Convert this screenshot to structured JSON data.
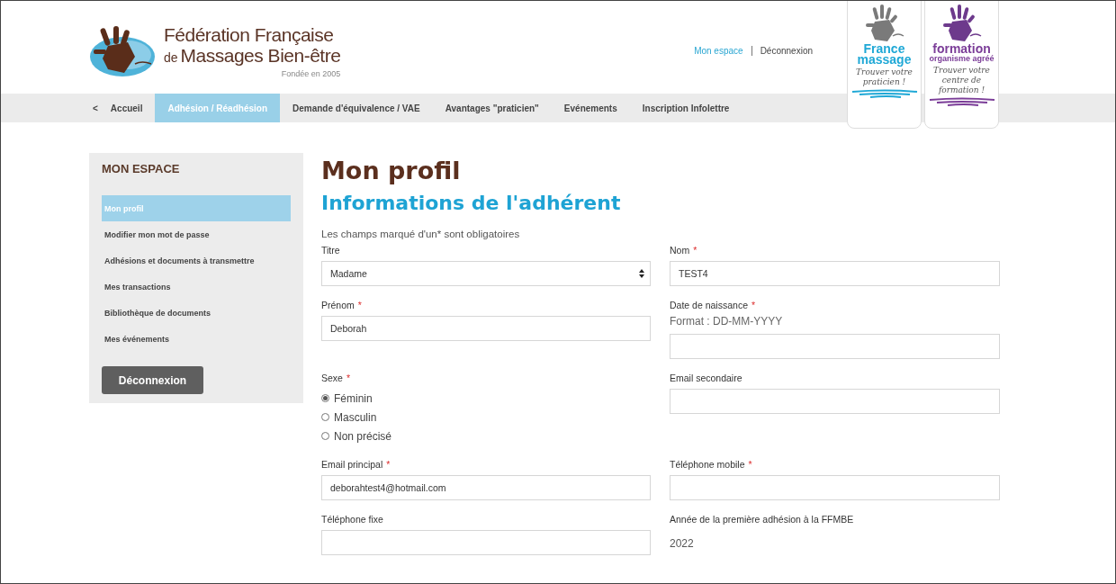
{
  "header": {
    "logo": {
      "title_line_1": "Fédération Française",
      "title_line_2_prefix": "de",
      "title_line_2": "Massages Bien-être",
      "tagline": "Fondée en 2005"
    },
    "top_links": [
      {
        "label": "Mon espace",
        "selected": true
      },
      {
        "label": "Déconnexion",
        "selected": false
      }
    ],
    "badges": [
      {
        "kind": "massage",
        "title": "France",
        "title_2": "massage",
        "caption": "Trouver votre praticien !",
        "color": "#1fa8d6"
      },
      {
        "kind": "formation",
        "title": "formation",
        "title_2": "organisme agréé",
        "caption": "Trouver votre centre de formation !",
        "color": "#7b3d98"
      }
    ]
  },
  "nav": [
    {
      "label": "<",
      "kind": "back"
    },
    {
      "label": "Accueil",
      "selected": false
    },
    {
      "label": "Adhésion / Réadhésion",
      "selected": true
    },
    {
      "label": "Demande d'équivalence / VAE",
      "selected": false
    },
    {
      "label": "Avantages \"praticien\"",
      "selected": false
    },
    {
      "label": "Evénements",
      "selected": false
    },
    {
      "label": "Inscription Infolettre",
      "selected": false
    }
  ],
  "sidebar": {
    "title": "MON ESPACE",
    "items": [
      {
        "label": "Mon profil",
        "selected": true
      },
      {
        "label": "Modifier mon mot de passe",
        "selected": false
      },
      {
        "label": "Adhésions et documents à transmettre",
        "selected": false
      },
      {
        "label": "Mes transactions",
        "selected": false
      },
      {
        "label": "Bibliothèque de documents",
        "selected": false
      },
      {
        "label": "Mes événements",
        "selected": false
      }
    ],
    "logout_button": "Déconnexion"
  },
  "page_title": "Mon profil",
  "section_title": "Informations de l'adhérent",
  "required_note": "Les champs marqué d'un* sont obligatoires",
  "fields": [
    {
      "kind": "select",
      "label": "Titre",
      "value": "Madame"
    },
    {
      "kind": "text",
      "label": "Nom",
      "required_mark": "*",
      "value": "TEST4"
    },
    {
      "kind": "text",
      "label": "Prénom",
      "required_mark": "*",
      "value": "Deborah"
    },
    {
      "kind": "text",
      "label": "Date de naissance",
      "required_mark": "*",
      "hint": "Format : DD-MM-YYYY"
    },
    {
      "kind": "radio",
      "label": "Sexe",
      "required_mark": "*",
      "options": [
        {
          "label": "Féminin",
          "selected": true
        },
        {
          "label": "Masculin",
          "selected": false
        },
        {
          "label": "Non précisé",
          "selected": false
        }
      ]
    },
    {
      "kind": "text",
      "label": "Email secondaire"
    },
    {
      "kind": "text",
      "label": "Email principal",
      "required_mark": "*",
      "value": "deborahtest4@hotmail.com"
    },
    {
      "kind": "text",
      "label": "Téléphone mobile",
      "required_mark": "*"
    },
    {
      "kind": "text",
      "label": "Téléphone fixe"
    },
    {
      "kind": "static",
      "label": "Année de la première adhésion à la FFMBE",
      "value": "2022"
    }
  ]
}
